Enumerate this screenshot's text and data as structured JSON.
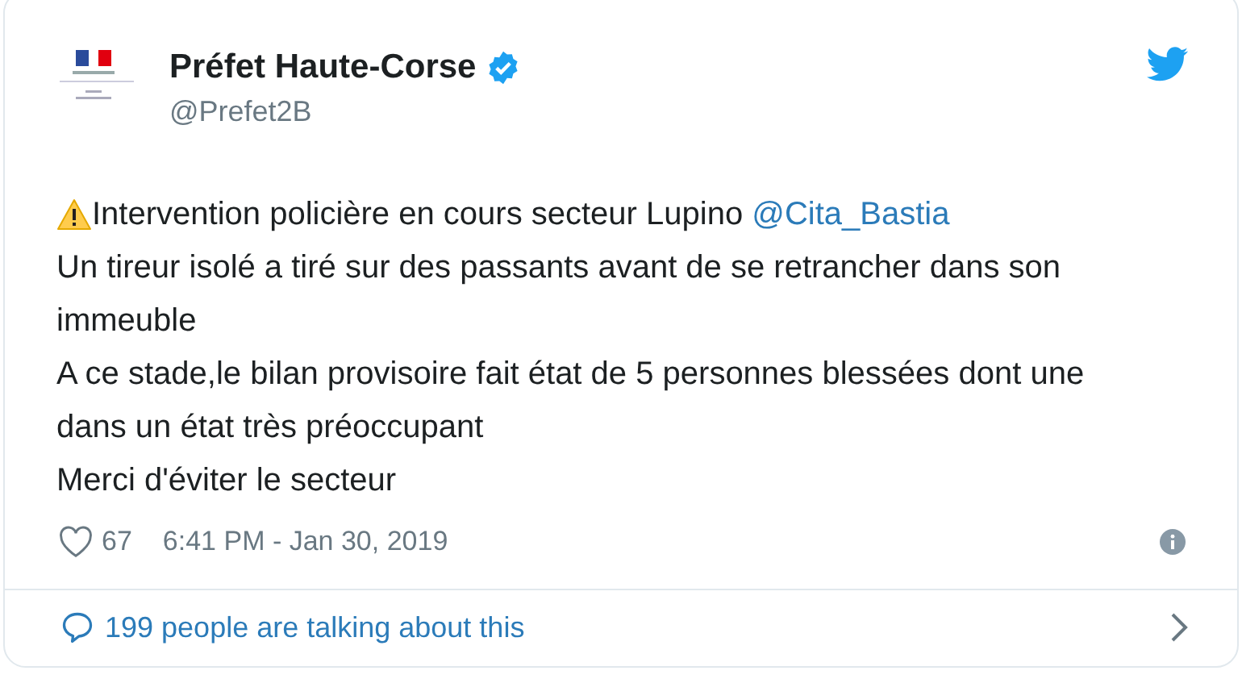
{
  "author": {
    "name": "Préfet Haute-Corse",
    "verified": true,
    "handle": "@Prefet2B"
  },
  "body": {
    "paragraphs": [
      {
        "text": "Intervention policière en cours secteur Lupino",
        "mention": "@Cita_Bastia",
        "warning": true
      },
      {
        "text": "Un tireur isolé a tiré sur des passants avant de se retrancher dans son immeuble",
        "warning": false
      },
      {
        "text": "A ce stade,le bilan provisoire fait état de 5 personnes blessées dont une dans un état très préoccupant",
        "warning": false
      },
      {
        "text": "Merci d'éviter le secteur",
        "warning": false
      }
    ]
  },
  "footer": {
    "likes": "67",
    "timestamp": "6:41 PM - Jan 30, 2019"
  },
  "conversation": {
    "label": "199 people are talking about this"
  }
}
